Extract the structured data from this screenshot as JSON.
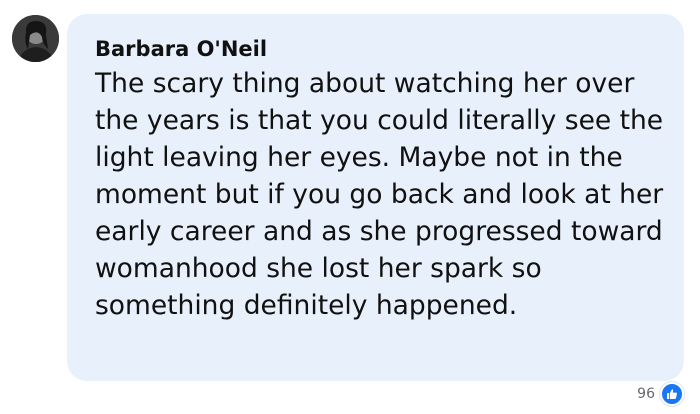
{
  "comment": {
    "author": "Barbara O'Neil",
    "text": "The scary thing about watching her over the years is that you could literally see the light leaving her eyes. Maybe not in the moment but if you go back and look at her early career and as she progressed toward womanhood she lost her spark so something definitely happened."
  },
  "reactions": {
    "count": "96",
    "icon": "thumbs-up-icon"
  },
  "colors": {
    "bubble_background": "#e8f1fb",
    "like_blue": "#1877f2",
    "count_gray": "#65676b"
  }
}
